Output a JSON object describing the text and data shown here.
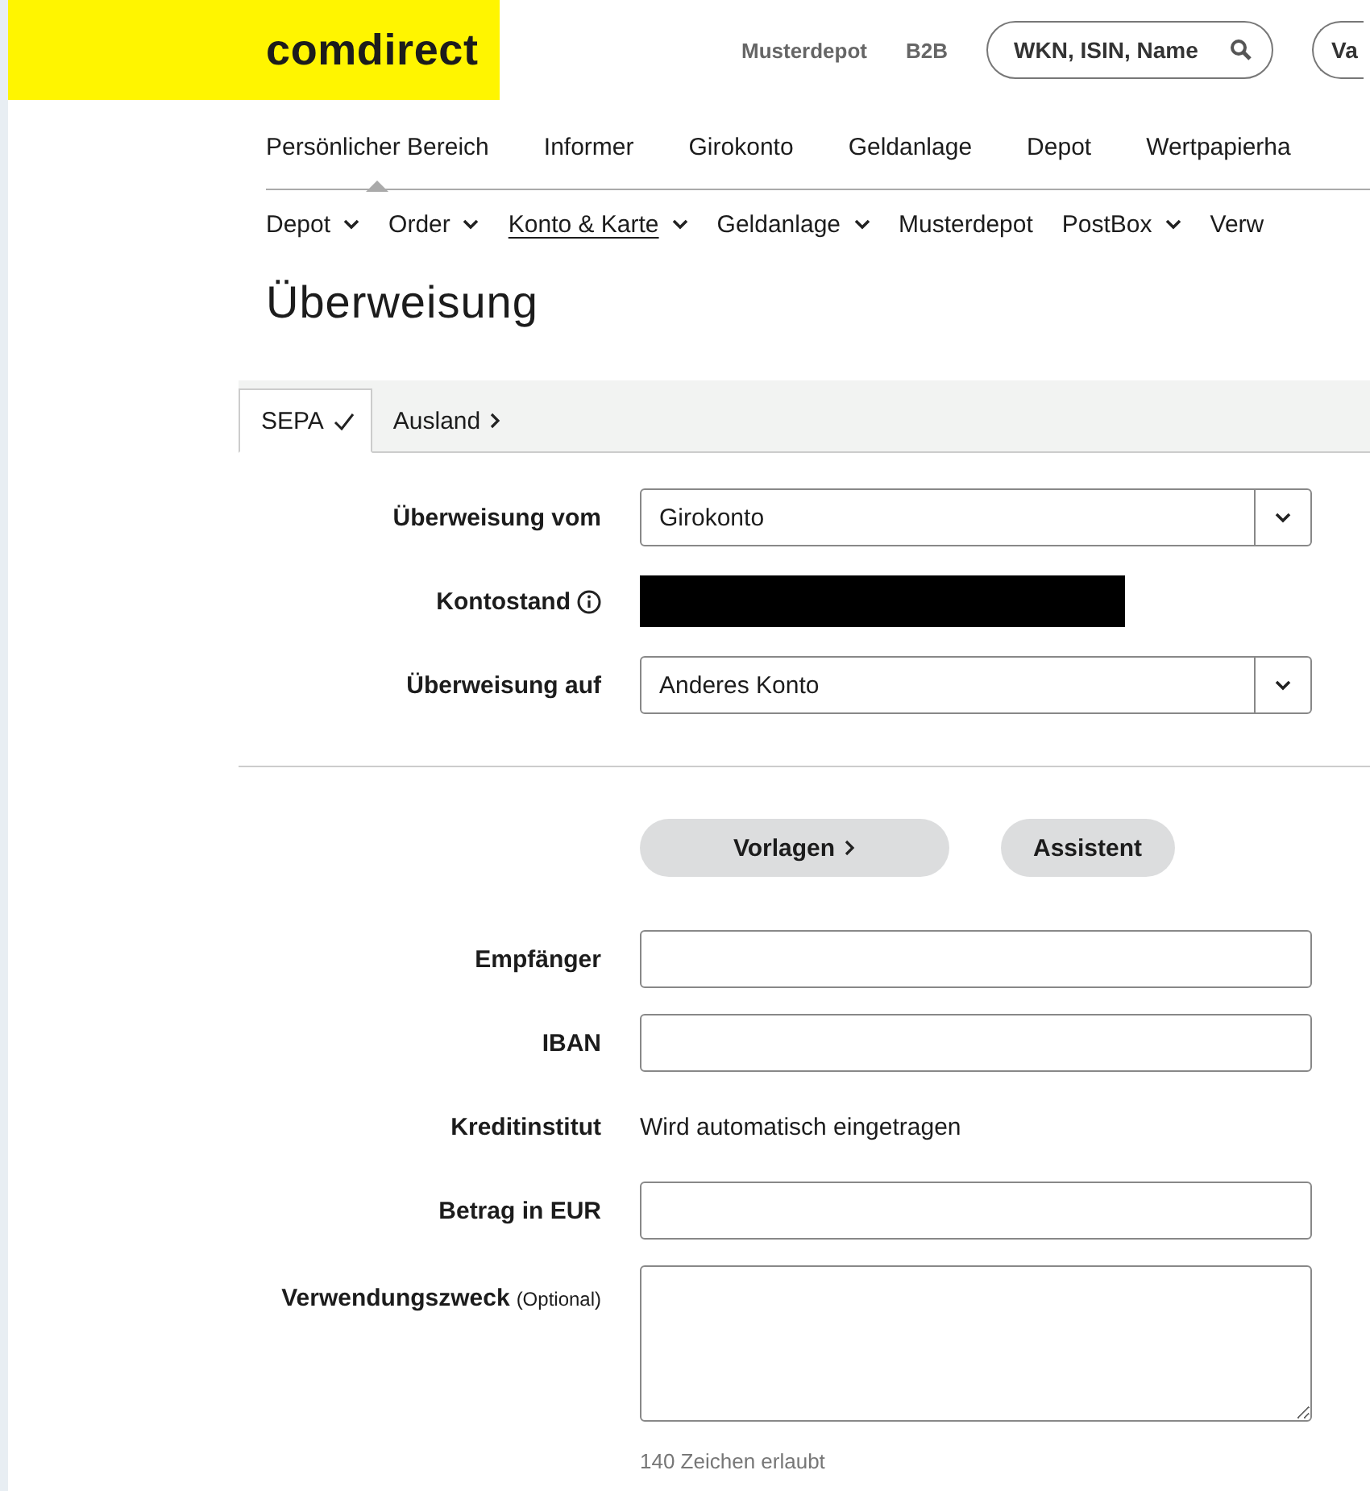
{
  "header": {
    "logo": "comdirect",
    "links": [
      "Musterdepot",
      "B2B"
    ],
    "search": {
      "placeholder": "WKN, ISIN, Name"
    },
    "cut_button": "Va"
  },
  "main_nav": [
    {
      "label": "Persönlicher Bereich",
      "selected": true
    },
    {
      "label": "Informer",
      "selected": false
    },
    {
      "label": "Girokonto",
      "selected": false
    },
    {
      "label": "Geldanlage",
      "selected": false
    },
    {
      "label": "Depot",
      "selected": false
    },
    {
      "label": "Wertpapierha",
      "selected": false
    }
  ],
  "sub_nav": [
    {
      "label": "Depot",
      "dropdown": true,
      "selected": false
    },
    {
      "label": "Order",
      "dropdown": true,
      "selected": false
    },
    {
      "label": "Konto & Karte",
      "dropdown": true,
      "selected": true
    },
    {
      "label": "Geldanlage",
      "dropdown": true,
      "selected": false
    },
    {
      "label": "Musterdepot",
      "dropdown": false,
      "selected": false
    },
    {
      "label": "PostBox",
      "dropdown": true,
      "selected": false
    },
    {
      "label": "Verw",
      "dropdown": false,
      "selected": false
    }
  ],
  "page_title": "Überweisung",
  "tabs": [
    {
      "label": "SEPA",
      "selected": true
    },
    {
      "label": "Ausland",
      "selected": false
    }
  ],
  "account_rows": [
    {
      "kind": "select",
      "label": "Überweisung vom",
      "value": "Girokonto"
    },
    {
      "kind": "redacted",
      "label": "Kontostand"
    },
    {
      "kind": "select",
      "label": "Überweisung auf",
      "value": "Anderes Konto"
    }
  ],
  "buttons": [
    {
      "label": "Vorlagen",
      "chevron": true
    },
    {
      "label": "Assistent",
      "chevron": false
    }
  ],
  "form_rows": [
    {
      "kind": "input",
      "label": "Empfänger"
    },
    {
      "kind": "input",
      "label": "IBAN"
    },
    {
      "kind": "text",
      "label": "Kreditinstitut",
      "value": "Wird automatisch eingetragen"
    },
    {
      "kind": "input",
      "label": "Betrag in EUR"
    },
    {
      "kind": "textarea",
      "label": "Verwendungszweck",
      "note": "(Optional)",
      "hint": "140 Zeichen erlaubt"
    }
  ]
}
